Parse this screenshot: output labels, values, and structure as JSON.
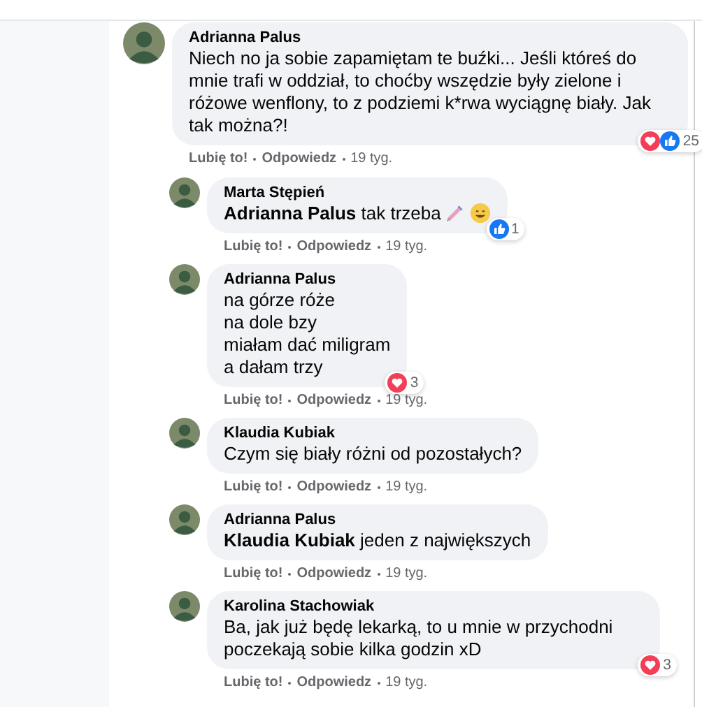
{
  "comments": [
    {
      "author": "Adrianna Palus",
      "text": "Niech no ja sobie zapamiętam te buźki... Jeśli któreś do mnie trafi w oddział, to choćby wszędzie były zielone i różowe wenflony, to z podziemi k*rwa wyciągnę biały. Jak tak można?!",
      "like": "Lubię to!",
      "reply": "Odpowiedz",
      "time": "19 tyg.",
      "reactions": [
        {
          "kind": "heart"
        },
        {
          "kind": "like"
        }
      ],
      "reaction_count": "25",
      "children": [
        {
          "author": "Marta Stępień",
          "text": "**Adrianna Palus** tak trzeba",
          "emojis": [
            {
              "kind": "syringe"
            },
            {
              "kind": "smile"
            }
          ],
          "like": "Lubię to!",
          "reply": "Odpowiedz",
          "time": "19 tyg.",
          "reactions": [
            {
              "kind": "like"
            }
          ],
          "reaction_count": "1"
        },
        {
          "author": "Adrianna Palus",
          "lines": [
            "na górze róże",
            "na dole bzy",
            "miałam dać miligram",
            "a dałam trzy"
          ],
          "like": "Lubię to!",
          "reply": "Odpowiedz",
          "time": "19 tyg.",
          "reactions": [
            {
              "kind": "heart"
            }
          ],
          "reaction_count": "3"
        },
        {
          "author": "Klaudia Kubiak",
          "text": "Czym się biały różni od pozostałych?",
          "like": "Lubię to!",
          "reply": "Odpowiedz",
          "time": "19 tyg."
        },
        {
          "author": "Adrianna Palus",
          "text": "**Klaudia Kubiak** jeden z największych",
          "like": "Lubię to!",
          "reply": "Odpowiedz",
          "time": "19 tyg."
        },
        {
          "author": "Karolina Stachowiak",
          "text": "Ba, jak już będę lekarką, to u mnie w przychodni poczekają sobie kilka godzin xD",
          "like": "Lubię to!",
          "reply": "Odpowiedz",
          "time": "19 tyg.",
          "reactions": [
            {
              "kind": "heart"
            }
          ],
          "reaction_count": "3"
        }
      ]
    }
  ]
}
